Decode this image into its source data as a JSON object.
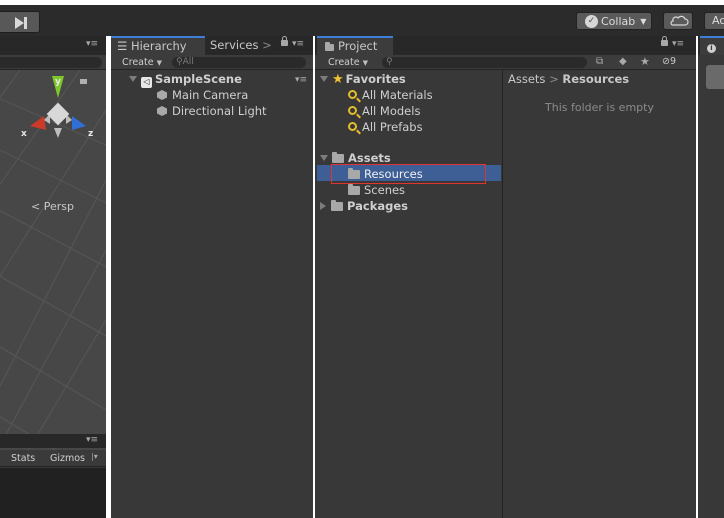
{
  "toolbar": {
    "collab_label": "Collab",
    "account_label": "Ac"
  },
  "scene": {
    "gizmo": {
      "y": "y",
      "x": "x",
      "z": "z"
    },
    "persp_label": "Persp",
    "stats_label": "Stats",
    "gizmos_label": "Gizmos"
  },
  "hierarchy": {
    "tab_label": "Hierarchy",
    "services_label": "Services",
    "create_label": "Create",
    "search_placeholder": "All",
    "scene_name": "SampleScene",
    "objects": [
      "Main Camera",
      "Directional Light"
    ]
  },
  "project": {
    "tab_label": "Project",
    "create_label": "Create",
    "hidden_count": "9",
    "favorites_label": "Favorites",
    "favorites": [
      "All Materials",
      "All Models",
      "All Prefabs"
    ],
    "assets_label": "Assets",
    "asset_folders": [
      "Resources",
      "Scenes"
    ],
    "packages_label": "Packages",
    "breadcrumb": {
      "root": "Assets",
      "current": "Resources"
    },
    "empty_message": "This folder is empty"
  },
  "colors": {
    "selection": "#3e5f96",
    "highlight_box": "#e1332f",
    "active_tab_accent": "#3d7ed8"
  }
}
